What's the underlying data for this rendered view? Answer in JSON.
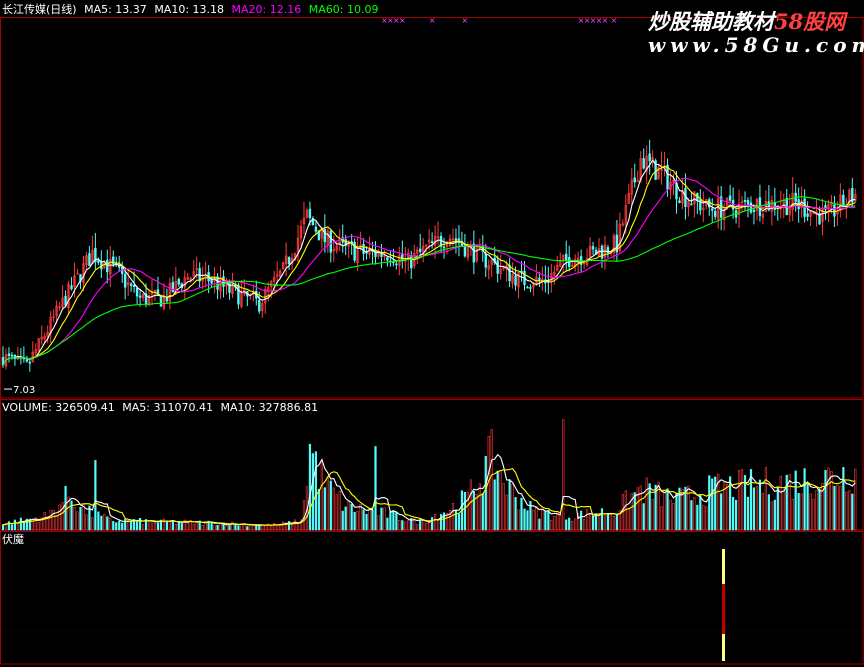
{
  "header": {
    "title": "长江传媒(日线)",
    "ma5_label": "MA5: 13.37",
    "ma10_label": "MA10: 13.18",
    "ma20_label": "MA20: 12.16",
    "ma60_label": "MA60: 10.09"
  },
  "volume_header": {
    "label": "VOLUME: 326509.41",
    "ma5_label": "MA5: 311070.41",
    "ma10_label": "MA10: 327886.81"
  },
  "indicator_panel": {
    "label": "伏魔"
  },
  "watermark": {
    "line1_a": "炒股辅助教材",
    "line1_b": "58股网",
    "line2": "www.58Gu.com"
  },
  "colors": {
    "background": "#000000",
    "up": "#ff3c3c",
    "down": "#54fcfc",
    "ma5": "#ffffff",
    "ma10": "#ffff00",
    "ma20": "#ff00ff",
    "ma60": "#00ff00",
    "panel_border": "#a00000",
    "grid": "#4a0000",
    "signal_red": "#c00000",
    "signal_yellow": "#ffff80"
  },
  "chart_data": {
    "type": "candlestick",
    "annotations": [
      "7.03"
    ],
    "signal_markers": "×",
    "price_keypoints": [
      [
        0,
        7.6
      ],
      [
        8,
        7.4
      ],
      [
        20,
        8.8
      ],
      [
        30,
        9.9
      ],
      [
        38,
        9.5
      ],
      [
        46,
        8.9
      ],
      [
        54,
        8.9
      ],
      [
        62,
        9.4
      ],
      [
        70,
        9.3
      ],
      [
        78,
        9.0
      ],
      [
        86,
        8.8
      ],
      [
        94,
        9.5
      ],
      [
        102,
        10.7
      ],
      [
        108,
        10.2
      ],
      [
        114,
        10.0
      ],
      [
        122,
        9.9
      ],
      [
        130,
        9.9
      ],
      [
        136,
        9.7
      ],
      [
        142,
        10.0
      ],
      [
        150,
        10.3
      ],
      [
        156,
        10.0
      ],
      [
        166,
        9.6
      ],
      [
        174,
        9.3
      ],
      [
        182,
        9.3
      ],
      [
        190,
        9.8
      ],
      [
        198,
        9.9
      ],
      [
        206,
        10.1
      ],
      [
        214,
        12.0
      ],
      [
        222,
        11.6
      ],
      [
        228,
        11.2
      ],
      [
        236,
        10.9
      ],
      [
        246,
        10.9
      ],
      [
        256,
        11.0
      ],
      [
        266,
        11.0
      ],
      [
        276,
        10.7
      ],
      [
        286,
        11.2
      ]
    ],
    "volume_keypoints": [
      [
        0,
        0.05
      ],
      [
        15,
        0.12
      ],
      [
        22,
        0.3
      ],
      [
        28,
        0.16
      ],
      [
        36,
        0.08
      ],
      [
        50,
        0.07
      ],
      [
        70,
        0.06
      ],
      [
        90,
        0.04
      ],
      [
        100,
        0.07
      ],
      [
        103,
        0.7
      ],
      [
        108,
        0.4
      ],
      [
        115,
        0.2
      ],
      [
        130,
        0.13
      ],
      [
        140,
        0.07
      ],
      [
        150,
        0.18
      ],
      [
        156,
        0.28
      ],
      [
        164,
        0.62
      ],
      [
        170,
        0.35
      ],
      [
        178,
        0.16
      ],
      [
        190,
        0.12
      ],
      [
        205,
        0.16
      ],
      [
        214,
        0.35
      ],
      [
        226,
        0.26
      ],
      [
        240,
        0.36
      ],
      [
        256,
        0.39
      ],
      [
        272,
        0.43
      ],
      [
        286,
        0.5
      ]
    ]
  }
}
